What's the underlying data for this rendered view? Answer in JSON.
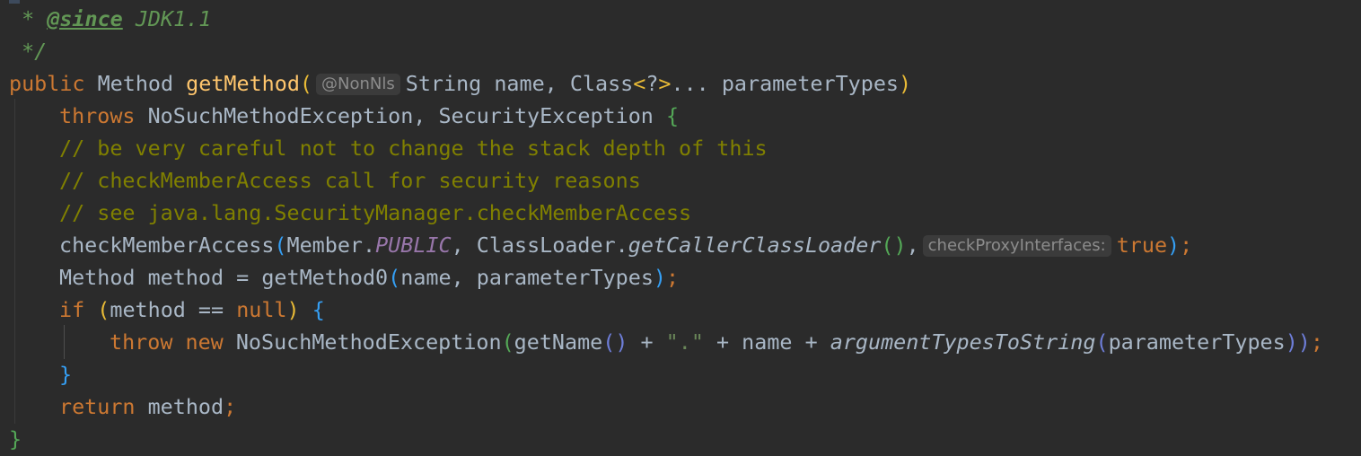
{
  "editor": {
    "lines": [
      {
        "indent": 0,
        "tokens": [
          {
            "t": " * ",
            "c": "doc"
          },
          {
            "t": "@since",
            "c": "doctag"
          },
          {
            "t": " JDK1.1",
            "c": "doc"
          }
        ]
      },
      {
        "indent": 0,
        "tokens": [
          {
            "t": " */",
            "c": "doc"
          }
        ]
      },
      {
        "indent": 0,
        "tokens": [
          {
            "t": "public",
            "c": "kw"
          },
          {
            "t": " Method ",
            "c": "pl"
          },
          {
            "t": "getMethod",
            "c": "fn"
          },
          {
            "t": "(",
            "c": "br1"
          },
          {
            "hint": "@NonNls"
          },
          {
            "t": "String name, Class",
            "c": "pl"
          },
          {
            "t": "<",
            "c": "br1"
          },
          {
            "t": "?",
            "c": "pl"
          },
          {
            "t": ">",
            "c": "br1"
          },
          {
            "t": "... parameterTypes",
            "c": "pl"
          },
          {
            "t": ")",
            "c": "br1"
          }
        ]
      },
      {
        "indent": 1,
        "tokens": [
          {
            "t": "throws",
            "c": "kw"
          },
          {
            "t": " NoSuchMethodException, SecurityException ",
            "c": "pl"
          },
          {
            "t": "{",
            "c": "br2"
          }
        ]
      },
      {
        "indent": 1,
        "tokens": [
          {
            "t": "// be very careful not to change the stack depth of this",
            "c": "com"
          }
        ]
      },
      {
        "indent": 1,
        "tokens": [
          {
            "t": "// checkMemberAccess call for security reasons",
            "c": "com"
          }
        ]
      },
      {
        "indent": 1,
        "tokens": [
          {
            "t": "// see java.lang.SecurityManager.checkMemberAccess",
            "c": "com"
          }
        ]
      },
      {
        "indent": 1,
        "tokens": [
          {
            "t": "checkMemberAccess",
            "c": "pl"
          },
          {
            "t": "(",
            "c": "br3"
          },
          {
            "t": "Member.",
            "c": "pl"
          },
          {
            "t": "PUBLIC",
            "c": "static"
          },
          {
            "t": ", ClassLoader.",
            "c": "pl"
          },
          {
            "t": "getCallerClassLoader",
            "c": "ital"
          },
          {
            "t": "()",
            "c": "br2"
          },
          {
            "t": ",",
            "c": "pl"
          },
          {
            "hint": "checkProxyInterfaces:"
          },
          {
            "t": "true",
            "c": "kw"
          },
          {
            "t": ")",
            "c": "br3"
          },
          {
            "t": ";",
            "c": "kw"
          }
        ]
      },
      {
        "indent": 1,
        "tokens": [
          {
            "t": "Method method = getMethod0",
            "c": "pl"
          },
          {
            "t": "(",
            "c": "br3"
          },
          {
            "t": "name, parameterTypes",
            "c": "pl"
          },
          {
            "t": ")",
            "c": "br3"
          },
          {
            "t": ";",
            "c": "kw"
          }
        ]
      },
      {
        "indent": 1,
        "tokens": [
          {
            "t": "if",
            "c": "kw"
          },
          {
            "t": " ",
            "c": "pl"
          },
          {
            "t": "(",
            "c": "br1"
          },
          {
            "t": "method == ",
            "c": "pl"
          },
          {
            "t": "null",
            "c": "kw"
          },
          {
            "t": ")",
            "c": "br1"
          },
          {
            "t": " ",
            "c": "pl"
          },
          {
            "t": "{",
            "c": "br3"
          }
        ]
      },
      {
        "indent": 2,
        "tokens": [
          {
            "t": "throw new",
            "c": "kw"
          },
          {
            "t": " NoSuchMethodException",
            "c": "pl"
          },
          {
            "t": "(",
            "c": "br2"
          },
          {
            "t": "getName",
            "c": "pl"
          },
          {
            "t": "()",
            "c": "br4"
          },
          {
            "t": " + ",
            "c": "pl"
          },
          {
            "t": "\".\"",
            "c": "str"
          },
          {
            "t": " + name + ",
            "c": "pl"
          },
          {
            "t": "argumentTypesToString",
            "c": "ital"
          },
          {
            "t": "(",
            "c": "br4"
          },
          {
            "t": "parameterTypes",
            "c": "pl"
          },
          {
            "t": "))",
            "c": "br4"
          },
          {
            "t": ";",
            "c": "kw"
          }
        ]
      },
      {
        "indent": 1,
        "tokens": [
          {
            "t": "}",
            "c": "br3"
          }
        ]
      },
      {
        "indent": 1,
        "tokens": [
          {
            "t": "return",
            "c": "kw"
          },
          {
            "t": " method",
            "c": "pl"
          },
          {
            "t": ";",
            "c": "kw"
          }
        ]
      },
      {
        "indent": 0,
        "tokens": [
          {
            "t": "}",
            "c": "br2"
          }
        ]
      }
    ]
  }
}
